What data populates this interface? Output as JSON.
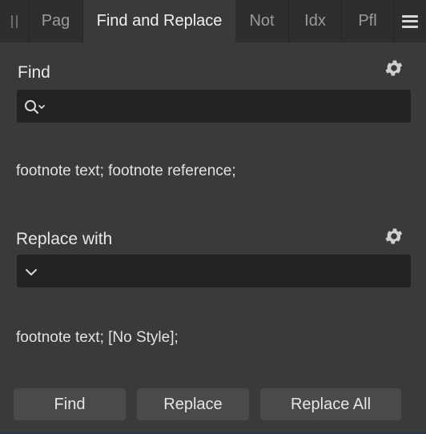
{
  "tabs": [
    {
      "label": "Pag"
    },
    {
      "label": "Find and Replace"
    },
    {
      "label": "Not"
    },
    {
      "label": "Idx"
    },
    {
      "label": "Pfl"
    }
  ],
  "active_tab": "Find and Replace",
  "find": {
    "label": "Find",
    "value": "",
    "summary": "footnote text; footnote reference;"
  },
  "replace": {
    "label": "Replace with",
    "value": "",
    "summary": "footnote text; [No Style];"
  },
  "buttons": {
    "find": "Find",
    "replace": "Replace",
    "replace_all": "Replace All"
  },
  "icons": {
    "grip": "panel-grip-icon",
    "menu": "hamburger-menu-icon",
    "find_settings": "gear-icon",
    "replace_settings": "gear-icon",
    "search": "search-icon",
    "dropdown": "chevron-down-icon"
  },
  "colors": {
    "panel_bg": "#3a3a3a",
    "tabbar_bg": "#2e2e2e",
    "field_bg": "#222222",
    "button_bg": "#4a4a4a"
  }
}
